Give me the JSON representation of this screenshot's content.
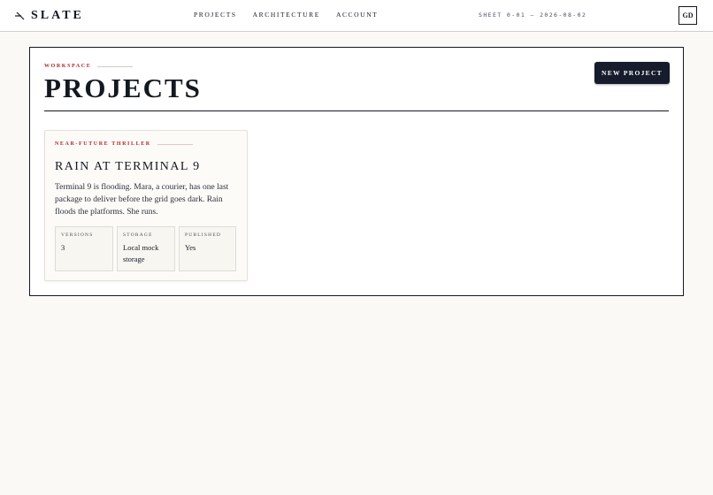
{
  "brand": {
    "name": "SLATE",
    "mark_icon": "slate-brand-mark-icon"
  },
  "nav": {
    "items": [
      {
        "label": "PROJECTS"
      },
      {
        "label": "ARCHITECTURE"
      },
      {
        "label": "ACCOUNT"
      }
    ]
  },
  "header": {
    "sheet_meta": "SHEET 0-01 — 2026-08-02",
    "avatar_initials": "GD"
  },
  "workspace": {
    "eyebrow": "WORKSPACE",
    "title": "PROJECTS",
    "new_project_label": "NEW PROJECT"
  },
  "projects": [
    {
      "genre": "NEAR-FUTURE THRILLER",
      "title": "RAIN AT TERMINAL 9",
      "description": "Terminal 9 is flooding. Mara, a courier, has one last package to deliver before the grid goes dark. Rain floods the platforms. She runs.",
      "stats": [
        {
          "label": "VERSIONS",
          "value": "3"
        },
        {
          "label": "STORAGE",
          "value": "Local mock storage"
        },
        {
          "label": "PUBLISHED",
          "value": "Yes"
        }
      ]
    }
  ],
  "colors": {
    "accent_red": "#b2262d",
    "ink": "#141821",
    "button_bg": "#161c2c",
    "page_bg": "#faf9f5"
  }
}
